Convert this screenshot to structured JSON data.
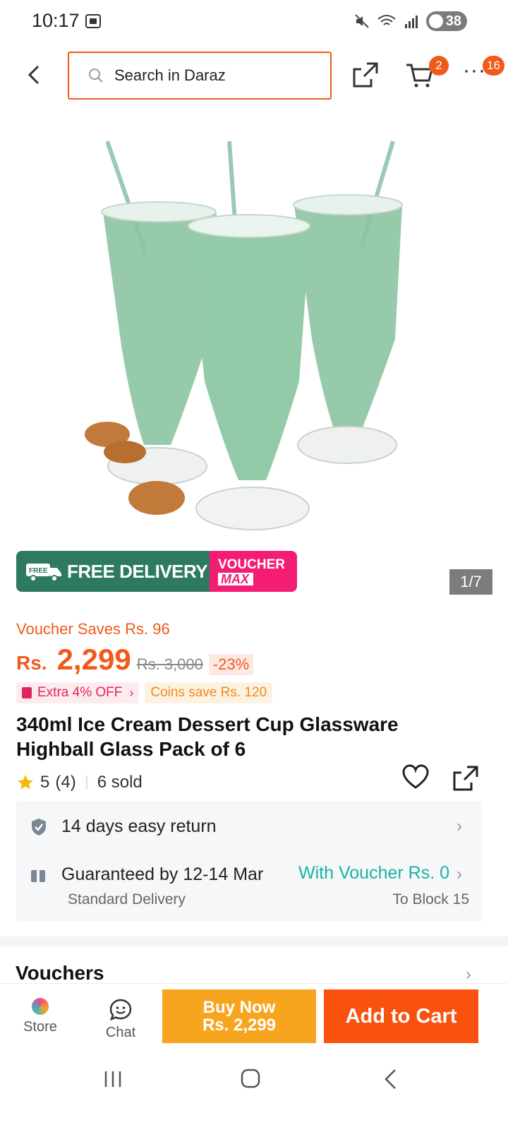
{
  "status_bar": {
    "time": "10:17",
    "battery": "38"
  },
  "header": {
    "search_placeholder": "Search in Daraz",
    "cart_count": "2",
    "more_count": "16"
  },
  "gallery": {
    "counter": "1/7"
  },
  "promo": {
    "free_tag": "FREE",
    "free_delivery": "FREE DELIVERY",
    "voucher": "VOUCHER",
    "max": "MAX"
  },
  "price": {
    "voucher_saves": "Voucher Saves Rs. 96",
    "currency": "Rs.",
    "current": "2,299",
    "original": "Rs. 3,000",
    "discount": "-23%"
  },
  "chips": {
    "extra_off": "Extra 4% OFF",
    "coins": "Coins save Rs. 120"
  },
  "product": {
    "title": "340ml Ice Cream Dessert Cup Glassware Highball Glass Pack of 6"
  },
  "rating": {
    "score": "5",
    "count": "(4)",
    "sold": "6 sold"
  },
  "service": {
    "returns": "14 days easy return",
    "guarantee": "Guaranteed by 12-14 Mar",
    "voucher_shipping": "With Voucher Rs. 0",
    "delivery_type": "Standard Delivery",
    "destination": "To Block 15"
  },
  "sections": {
    "vouchers": "Vouchers"
  },
  "bottom_bar": {
    "store": "Store",
    "chat": "Chat",
    "buy_now": "Buy Now",
    "buy_now_price": "Rs. 2,299",
    "add_to_cart": "Add to Cart"
  },
  "colors": {
    "accent": "#f05a1a",
    "buy_now": "#f7a51f",
    "add_to_cart": "#f9520f",
    "voucher_green": "#1ab3a4",
    "promo_green": "#2d7a61",
    "promo_pink": "#f31e74"
  }
}
